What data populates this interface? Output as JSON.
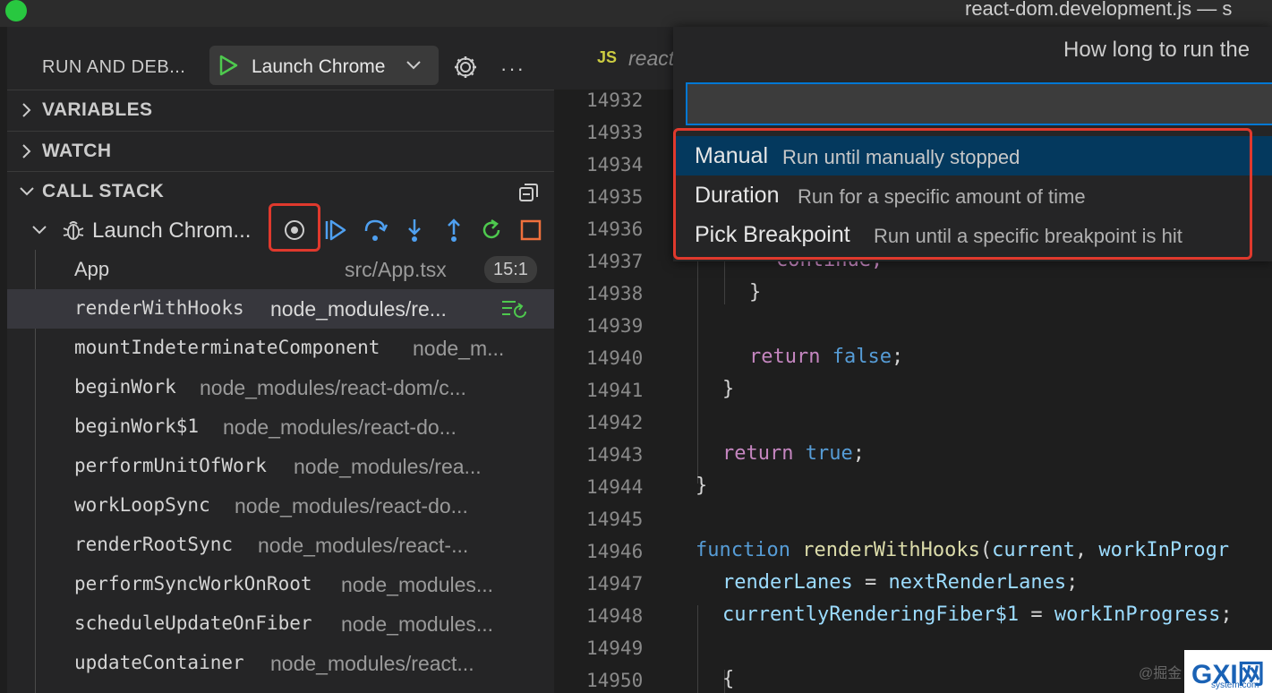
{
  "window": {
    "title": "react-dom.development.js — s"
  },
  "debug": {
    "title": "RUN AND DEB...",
    "config_label": "Launch Chrome",
    "sections": {
      "variables": "VARIABLES",
      "watch": "WATCH",
      "call_stack": "CALL STACK"
    },
    "session": {
      "label": "Launch Chrom..."
    },
    "frames": [
      {
        "name": "App",
        "path": "src/App.tsx",
        "badge": "15:1"
      },
      {
        "name": "renderWithHooks",
        "path": "node_modules/re..."
      },
      {
        "name": "mountIndeterminateComponent",
        "path": "node_m..."
      },
      {
        "name": "beginWork",
        "path": "node_modules/react-dom/c..."
      },
      {
        "name": "beginWork$1",
        "path": "node_modules/react-do..."
      },
      {
        "name": "performUnitOfWork",
        "path": "node_modules/rea..."
      },
      {
        "name": "workLoopSync",
        "path": "node_modules/react-do..."
      },
      {
        "name": "renderRootSync",
        "path": "node_modules/react-..."
      },
      {
        "name": "performSyncWorkOnRoot",
        "path": "node_modules..."
      },
      {
        "name": "scheduleUpdateOnFiber",
        "path": "node_modules..."
      },
      {
        "name": "updateContainer",
        "path": "node_modules/react..."
      }
    ],
    "colors": {
      "accent_red": "#e0392d",
      "play_green": "#4ec94e",
      "toolbar_blue": "#4fa0f0"
    }
  },
  "editor": {
    "tab": {
      "lang": "JS",
      "name": "react"
    },
    "line_numbers": [
      "14932",
      "14933",
      "14934",
      "14935",
      "14936",
      "14937",
      "14938",
      "14939",
      "14940",
      "14941",
      "14942",
      "14943",
      "14944",
      "14945",
      "14946",
      "14947",
      "14948",
      "14949",
      "14950"
    ],
    "code": {
      "l14937": "continue;",
      "l14938": "}",
      "l14940_kw": "return",
      "l14940_val": "false",
      "l14941": "}",
      "l14943_kw": "return",
      "l14943_val": "true",
      "l14944": "}",
      "l14946_kw": "function",
      "l14946_fn": "renderWithHooks",
      "l14946_p1": "current",
      "l14946_p2": "workInProgr",
      "l14947_a": "renderLanes",
      "l14947_b": "nextRenderLanes",
      "l14948_a": "currentlyRenderingFiber$1",
      "l14948_b": "workInProgress",
      "l14950": "{"
    }
  },
  "quickpick": {
    "title": "How long to run the",
    "input_value": "",
    "items": [
      {
        "label": "Manual",
        "description": "Run until manually stopped"
      },
      {
        "label": "Duration",
        "description": "Run for a specific amount of time"
      },
      {
        "label": "Pick Breakpoint",
        "description": "Run until a specific breakpoint is hit"
      }
    ]
  },
  "watermark": {
    "left_text": "@掘金",
    "logo": "GXI网",
    "sub": "system.com"
  }
}
